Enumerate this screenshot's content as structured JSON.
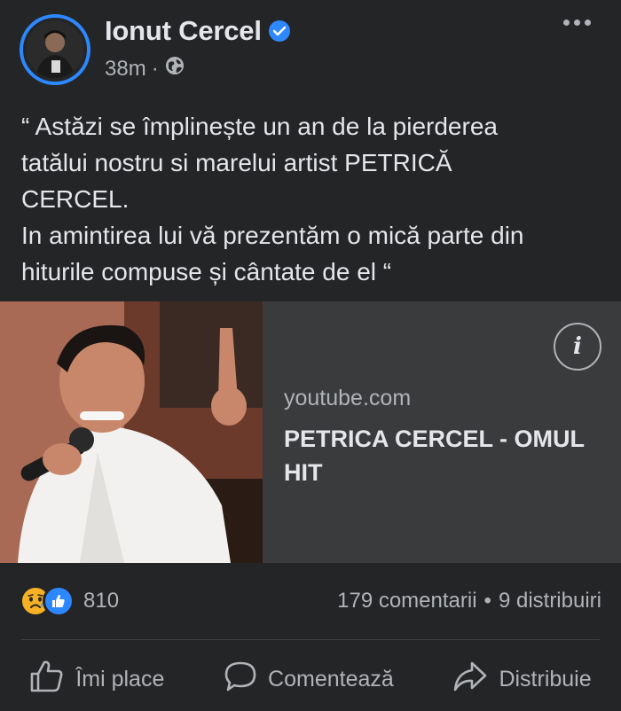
{
  "post": {
    "author": "Ionut Cercel",
    "time": "38m",
    "separator": "·",
    "text_lines": [
      "“ Astăzi se împlinește un an de la pierderea",
      "tatălui nostru si marelui artist PETRICĂ",
      "CERCEL.",
      "In amintirea lui vă prezentăm o mică parte din",
      "hiturile compuse și cântate de el “"
    ]
  },
  "link_card": {
    "domain": "youtube.com",
    "title": "PETRICA CERCEL - OMUL HIT"
  },
  "engagement": {
    "reaction_count": "810",
    "comments": "179 comentarii",
    "bullet": "•",
    "shares": "9 distribuiri"
  },
  "actions": {
    "like": "Îmi place",
    "comment": "Comentează",
    "share": "Distribuie"
  },
  "colors": {
    "background": "#242526",
    "card": "#3a3b3c",
    "accent": "#2d88ff",
    "text": "#e4e6eb",
    "muted": "#b0b3b8"
  },
  "icons": {
    "verified": "verified-badge-icon",
    "audience": "globe-icon",
    "more": "more-options-icon",
    "info": "info-icon",
    "sad": "sad-reaction-icon",
    "like_reaction": "like-reaction-icon",
    "like": "thumbs-up-icon",
    "comment": "speech-bubble-icon",
    "share": "share-arrow-icon"
  }
}
